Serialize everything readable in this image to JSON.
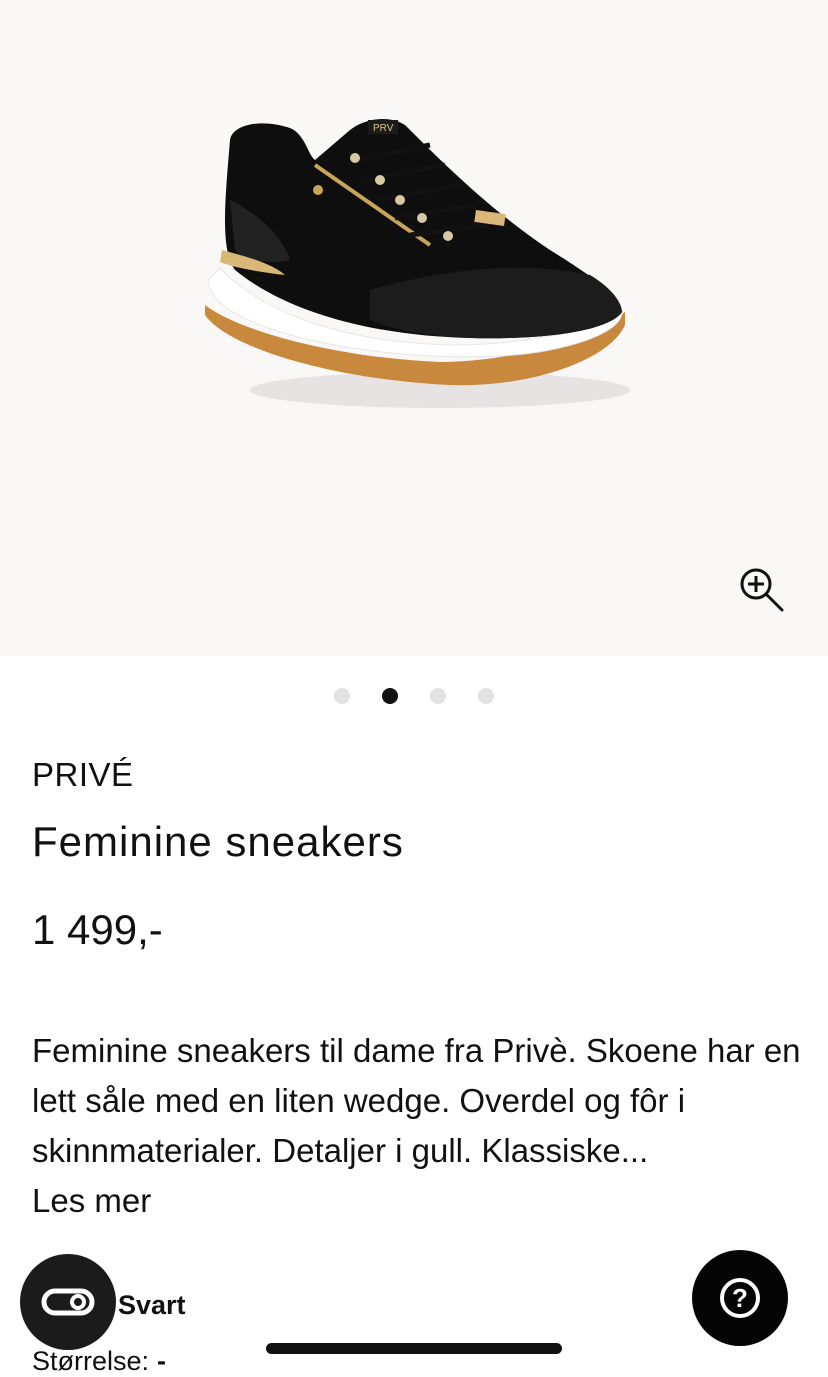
{
  "product": {
    "brand": "PRIVÉ",
    "title": "Feminine sneakers",
    "price": "1 499,-",
    "description": "Feminine sneakers til dame fra Privè. Skoene har en lett såle med en liten wedge. Overdel og fôr i skinnmaterialer. Detaljer i gull. Klassiske...",
    "read_more": "Les mer",
    "color_value": "Svart",
    "size_label": "Størrelse:",
    "size_value": "-"
  },
  "gallery": {
    "dot_count": 4,
    "active_index": 1,
    "zoom_icon": "zoom-in-icon",
    "logo_text": "PRV"
  },
  "fabs": {
    "left_icon": "toggle-link-icon",
    "right_icon": "help-question-icon",
    "right_glyph": "?"
  },
  "colors": {
    "hero_bg": "#f9f8f7",
    "text": "#111111",
    "dot_inactive": "#e2e2e2",
    "dot_active": "#111111",
    "fab_bg": "#1b1b1b"
  }
}
